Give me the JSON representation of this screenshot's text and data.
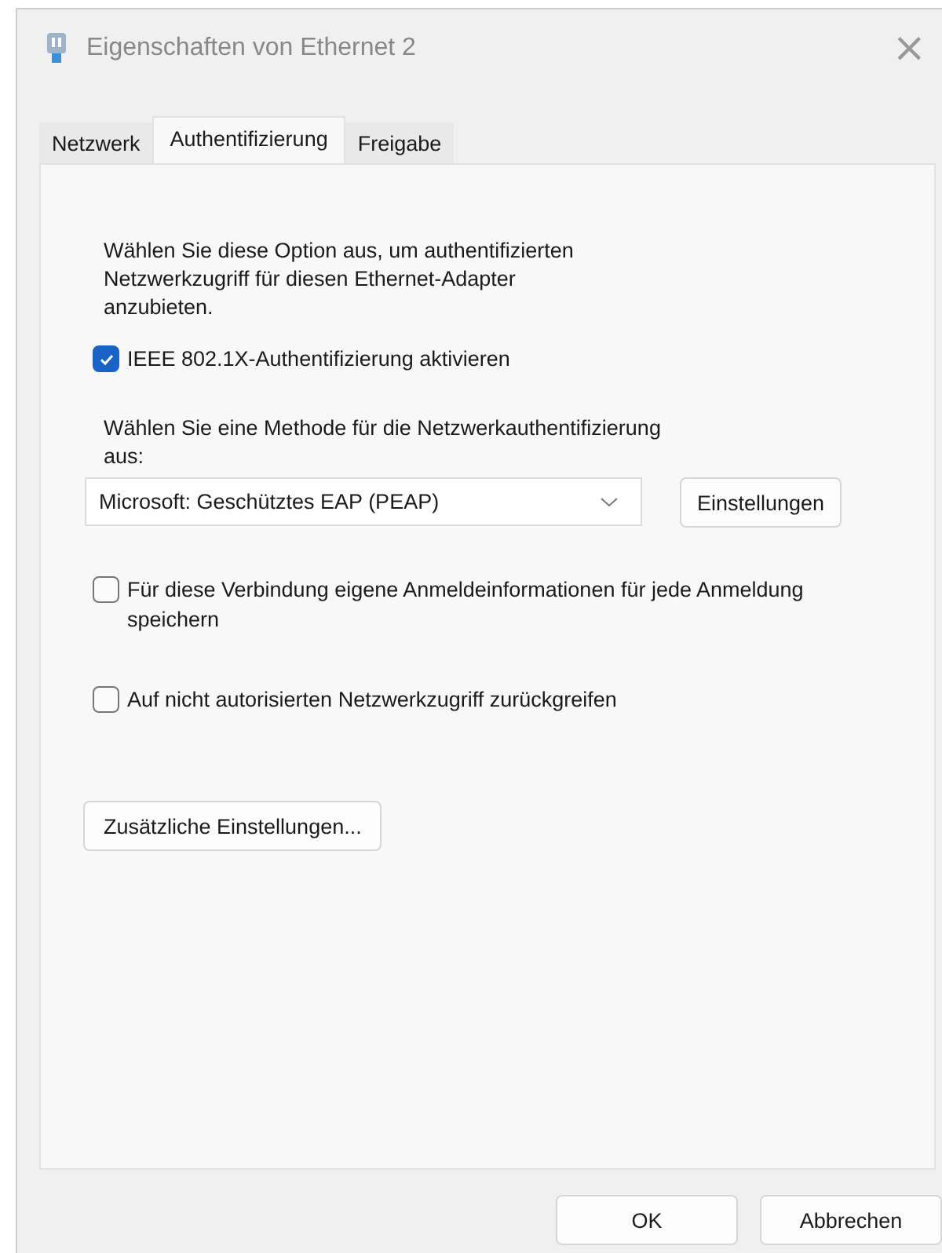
{
  "window": {
    "title": "Eigenschaften von Ethernet 2",
    "close": "×"
  },
  "tabs": [
    {
      "label": "Netzwerk",
      "selected": false
    },
    {
      "label": "Authentifizierung",
      "selected": true
    },
    {
      "label": "Freigabe",
      "selected": false
    }
  ],
  "description": "Wählen Sie diese Option aus, um authentifizierten Netzwerkzugriff für diesen Ethernet-Adapter anzubieten.",
  "enable_checkbox": {
    "label": "IEEE 802.1X-Authentifizierung aktivieren",
    "checked": true
  },
  "method_label": "Wählen Sie eine Methode für die Netzwerkauthentifizierung aus:",
  "method_dropdown": {
    "value": "Microsoft: Geschütztes EAP (PEAP)"
  },
  "settings_button": "Einstellungen",
  "options": [
    {
      "label": "Für diese Verbindung eigene Anmeldeinformationen für jede Anmeldung speichern",
      "checked": false
    },
    {
      "label": "Auf nicht autorisierten Netzwerkzugriff zurückgreifen",
      "checked": false
    }
  ],
  "additional_button": "Zusätzliche Einstellungen...",
  "buttons": [
    "OK",
    "Abbrechen"
  ]
}
